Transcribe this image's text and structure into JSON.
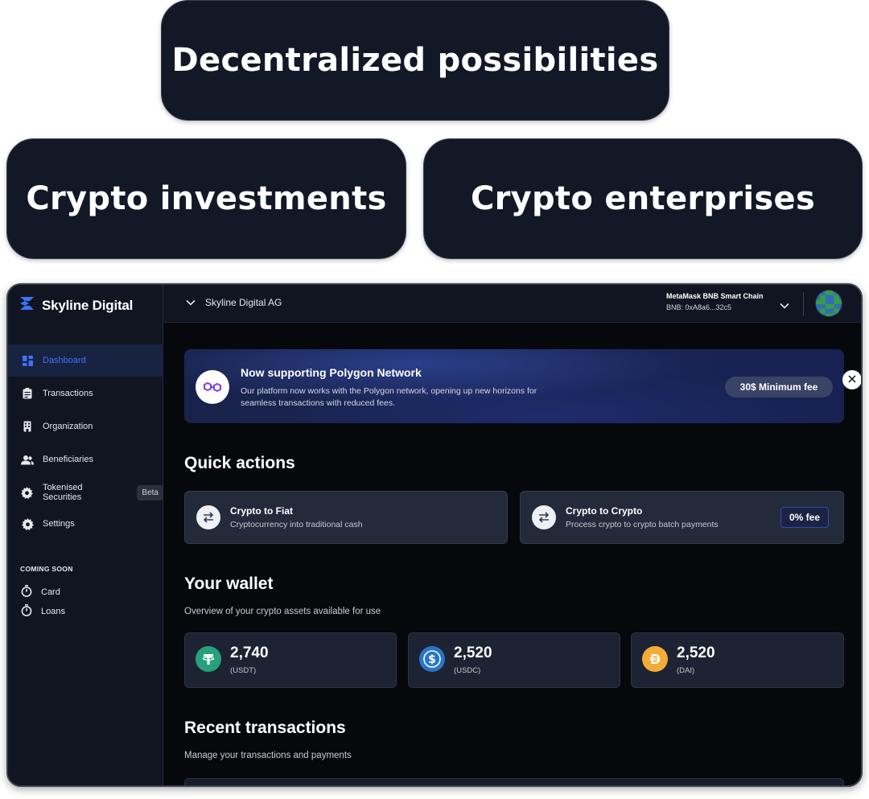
{
  "hero": {
    "top": "Decentralized possibilities",
    "left": "Crypto investments",
    "right": "Crypto enterprises"
  },
  "brand": {
    "name": "Skyline Digital"
  },
  "sidebar": {
    "items": [
      {
        "label": "Dashboard",
        "icon": "grid-icon",
        "active": true
      },
      {
        "label": "Transactions",
        "icon": "clipboard-icon"
      },
      {
        "label": "Organization",
        "icon": "building-icon"
      },
      {
        "label": "Beneficiaries",
        "icon": "users-icon"
      },
      {
        "label": "Tokenised Securities",
        "icon": "gear-icon",
        "badge": "Beta"
      },
      {
        "label": "Settings",
        "icon": "gear-icon"
      }
    ],
    "coming_soon_heading": "COMING SOON",
    "coming_soon": [
      {
        "label": "Card",
        "icon": "stopwatch-icon"
      },
      {
        "label": "Loans",
        "icon": "stopwatch-icon"
      }
    ]
  },
  "topbar": {
    "org_name": "Skyline Digital AG",
    "wallet_chain": "MetaMask BNB Smart Chain",
    "wallet_address": "BNB: 0xA8a6...32c5"
  },
  "banner": {
    "title": "Now supporting Polygon Network",
    "description": "Our platform now works with the Polygon network, opening up new horizons for seamless transactions with reduced fees.",
    "fee_label": "30$ Minimum fee"
  },
  "quick_actions": {
    "title": "Quick actions",
    "cards": [
      {
        "title": "Crypto to Fiat",
        "desc": "Cryptocurrency into traditional cash"
      },
      {
        "title": "Crypto to Crypto",
        "desc": "Process crypto to crypto batch payments",
        "badge": "0%  fee"
      }
    ]
  },
  "wallet": {
    "title": "Your wallet",
    "subtitle": "Overview of your crypto assets available for use",
    "assets": [
      {
        "value": "2,740",
        "unit": "(USDT)",
        "color": "#26a17b"
      },
      {
        "value": "2,520",
        "unit": "(USDC)",
        "color": "#2775ca"
      },
      {
        "value": "2,520",
        "unit": "(DAI)",
        "color": "#f5ac37"
      }
    ]
  },
  "transactions": {
    "title": "Recent transactions",
    "subtitle": "Manage your transactions and payments"
  },
  "colors": {
    "accent": "#3b74f6",
    "sidebar_bg": "#101521",
    "card_bg": "#232a3a"
  }
}
